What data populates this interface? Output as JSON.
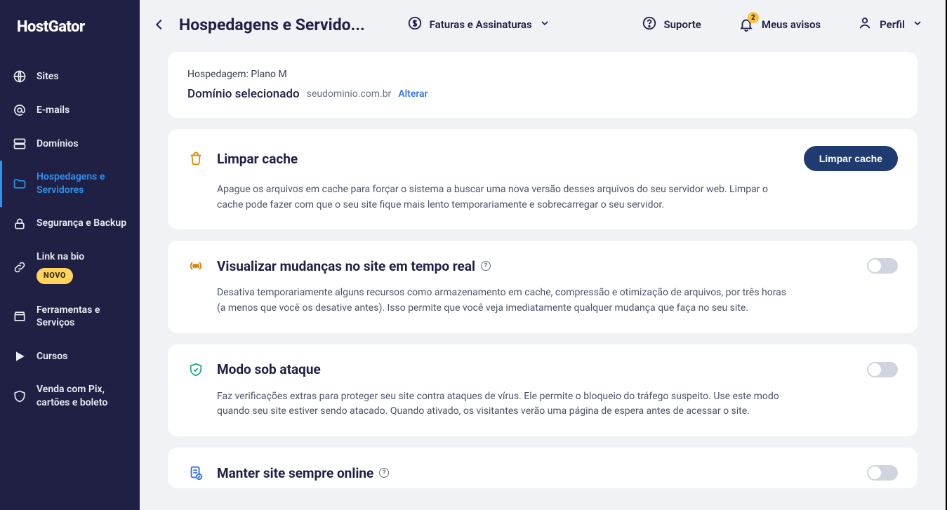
{
  "brand": "HostGator",
  "sidebar": {
    "items": [
      {
        "label": "Sites"
      },
      {
        "label": "E-mails"
      },
      {
        "label": "Domínios"
      },
      {
        "label": "Hospedagens e Servidores"
      },
      {
        "label": "Segurança e Backup"
      },
      {
        "label": "Link na bio",
        "badge": "NOVO"
      },
      {
        "label": "Ferramentas e Serviços"
      },
      {
        "label": "Cursos"
      },
      {
        "label": "Venda com Pix, cartões e boleto"
      }
    ]
  },
  "topbar": {
    "title": "Hospedagens e Servido...",
    "billing": "Faturas e Assinaturas",
    "support": "Suporte",
    "notices": "Meus avisos",
    "notice_count": "2",
    "profile": "Perfil"
  },
  "hosting_card": {
    "plan_label": "Hospedagem: Plano M",
    "domain_label": "Domínio selecionado",
    "domain_value": "seudominio.com.br",
    "change": "Alterar"
  },
  "cache_card": {
    "title": "Limpar cache",
    "button": "Limpar cache",
    "desc": "Apague os arquivos em cache para forçar o sistema a buscar uma nova versão desses arquivos do seu servidor web. Limpar o cache pode fazer com que o seu site fique mais lento temporariamente e sobrecarregar o seu servidor."
  },
  "realtime_card": {
    "title": "Visualizar mudanças no site em tempo real",
    "desc": "Desativa temporariamente alguns recursos como armazenamento em cache, compressão e otimização de arquivos, por três horas (a menos que você os desative antes). Isso permite que você veja imediatamente qualquer mudança que faça no seu site."
  },
  "attack_card": {
    "title": "Modo sob ataque",
    "desc": "Faz verificações extras para proteger seu site contra ataques de vírus. Ele permite o bloqueio do tráfego suspeito. Use este modo quando seu site estiver sendo atacado. Quando ativado, os visitantes verão uma página de espera antes de acessar o site."
  },
  "always_online_card": {
    "title": "Manter site sempre online"
  }
}
